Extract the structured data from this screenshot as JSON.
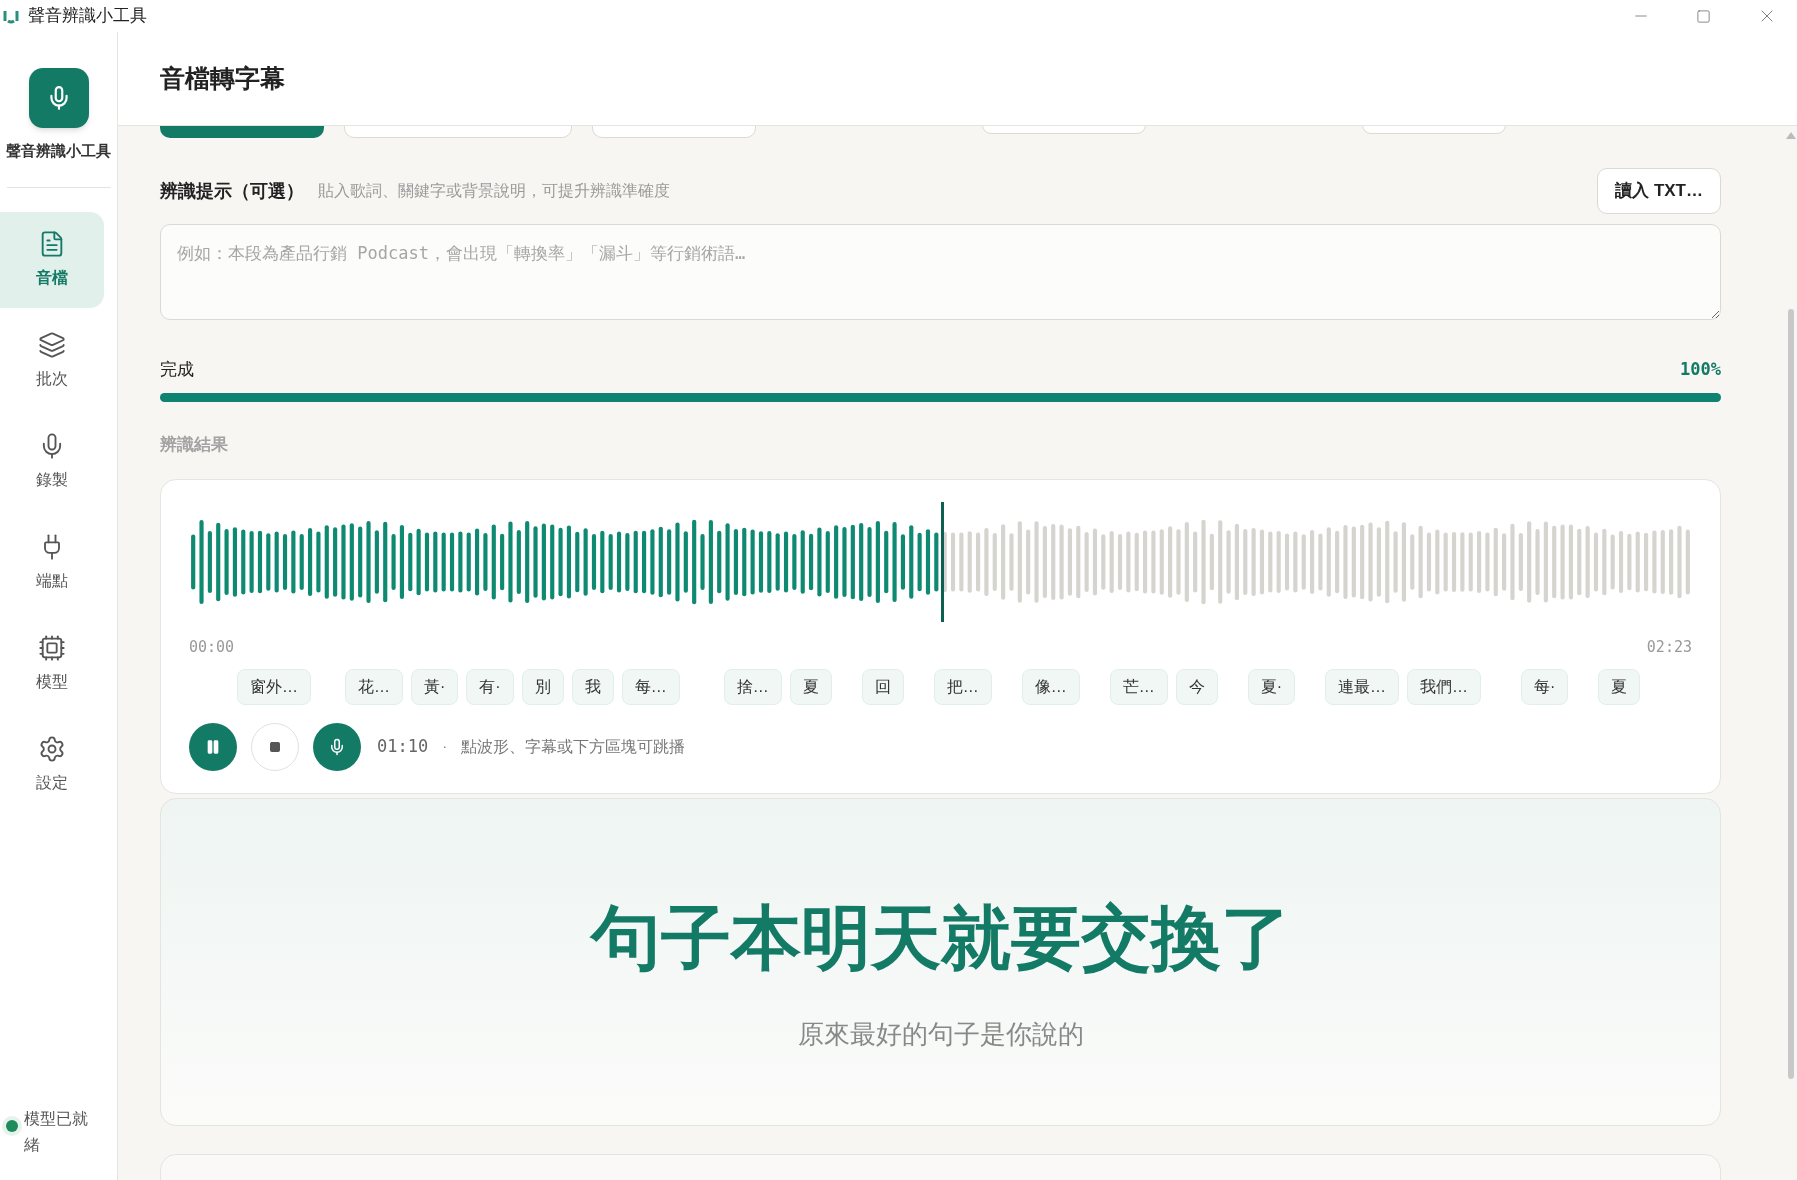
{
  "window": {
    "title": "聲音辨識小工具"
  },
  "sidebar": {
    "app_name": "聲音辨識小工具",
    "items": [
      {
        "label": "音檔",
        "selected": true
      },
      {
        "label": "批次",
        "selected": false
      },
      {
        "label": "錄製",
        "selected": false
      },
      {
        "label": "端點",
        "selected": false
      },
      {
        "label": "模型",
        "selected": false
      },
      {
        "label": "設定",
        "selected": false
      }
    ],
    "status": {
      "text": "模型已就緒",
      "color": "#1f8a5b"
    }
  },
  "header": {
    "title": "音檔轉字幕"
  },
  "hint": {
    "label": "辨識提示（可選）",
    "description": "貼入歌詞、關鍵字或背景說明，可提升辨識準確度",
    "load_button": "讀入 TXT…",
    "placeholder": "例如：本段為產品行銷 Podcast，會出現「轉換率」「漏斗」等行銷術語…"
  },
  "progress": {
    "label": "完成",
    "reading": "100%",
    "level": 1
  },
  "results": {
    "label": "辨識結果",
    "player": {
      "level": 0.5,
      "start": "00:00",
      "end": "02:23",
      "current": "01:10",
      "separator": "·",
      "tip": "點波形、字幕或下方區塊可跳播",
      "playing": true
    },
    "chips": [
      "窗外…",
      "花…",
      "黃·",
      "有·",
      "別",
      "我",
      "每…",
      "捨…",
      "夏",
      "回",
      "把…",
      "像…",
      "芒…",
      "今",
      "夏·",
      "連最…",
      "我們…",
      "每·",
      "夏"
    ],
    "current_line": "句子本明天就要交換了",
    "next_line": "原來最好的句子是你說的"
  }
}
